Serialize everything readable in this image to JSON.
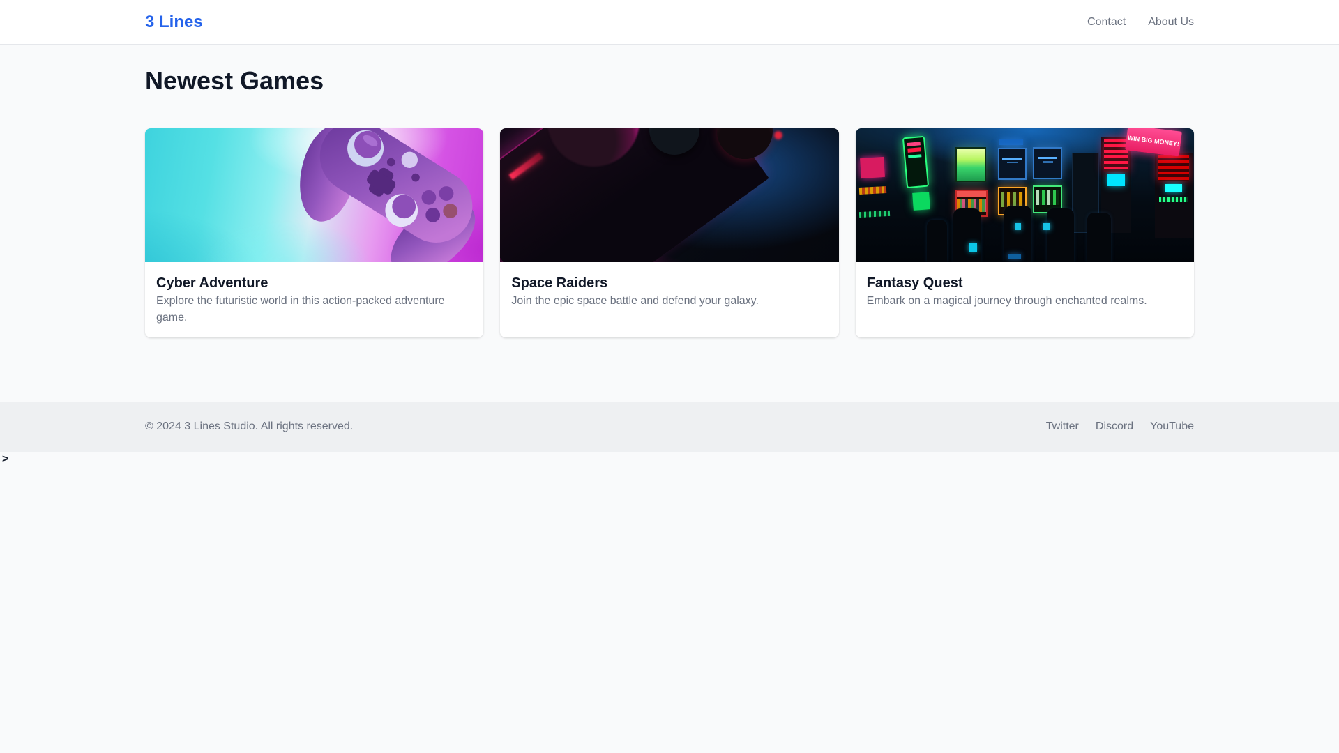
{
  "brand": {
    "name": "3 Lines",
    "color": "#2563eb"
  },
  "nav": {
    "links": [
      {
        "label": "Contact"
      },
      {
        "label": "About Us"
      }
    ]
  },
  "main": {
    "heading": "Newest Games"
  },
  "cards": [
    {
      "title": "Cyber Adventure",
      "description": "Explore the futuristic world in this action-packed adventure game.",
      "image_alt": "purple-game-controller-on-cyan-magenta-neon-gradient"
    },
    {
      "title": "Space Raiders",
      "description": "Join the epic space battle and defend your galaxy.",
      "image_alt": "dark-controller-closeup-with-blue-and-magenta-light"
    },
    {
      "title": "Fantasy Quest",
      "description": "Embark on a magical journey through enchanted realms.",
      "image_alt": "dark-arcade-room-with-neon-slot-machines",
      "sign_text": "WIN BIG MONEY!"
    }
  ],
  "footer": {
    "copyright": "© 2024 3 Lines Studio. All rights reserved.",
    "links": [
      {
        "label": "Twitter"
      },
      {
        "label": "Discord"
      },
      {
        "label": "YouTube"
      }
    ]
  },
  "stray_text": ">"
}
